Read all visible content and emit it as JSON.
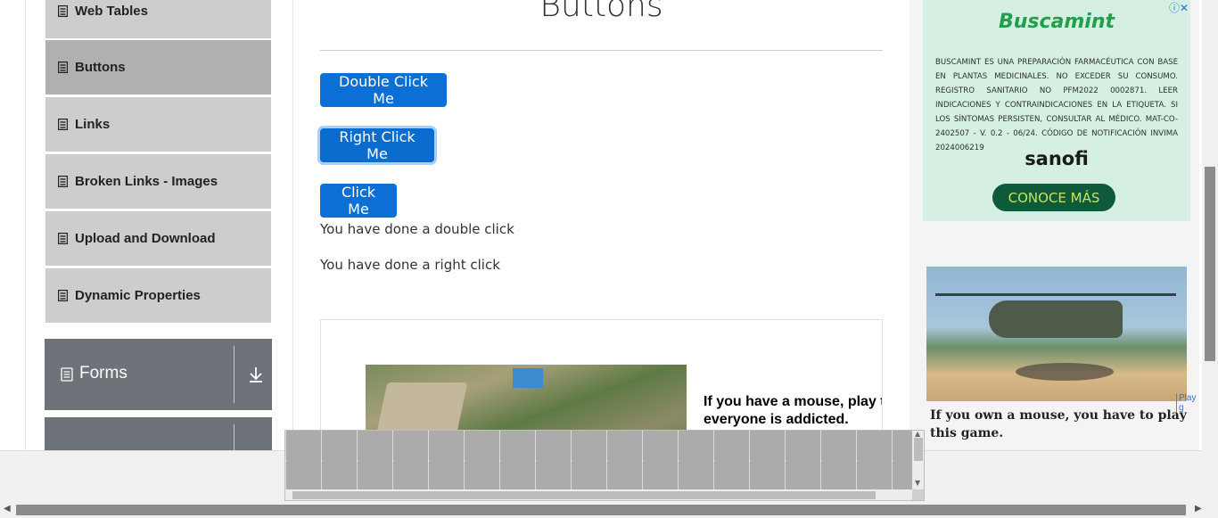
{
  "sidebar": {
    "items": [
      {
        "label": "Web Tables",
        "icon": "document-icon",
        "active": false
      },
      {
        "label": "Buttons",
        "icon": "document-icon",
        "active": true
      },
      {
        "label": "Links",
        "icon": "document-icon",
        "active": false
      },
      {
        "label": "Broken Links - Images",
        "icon": "document-icon",
        "active": false
      },
      {
        "label": "Upload and Download",
        "icon": "document-icon",
        "active": false
      },
      {
        "label": "Dynamic Properties",
        "icon": "document-icon",
        "active": false
      }
    ],
    "groups": [
      {
        "label": "Forms",
        "icon": "notes-icon"
      }
    ]
  },
  "main": {
    "title": "Buttons",
    "buttons": {
      "double_click": "Double Click Me",
      "right_click": "Right Click Me",
      "click": "Click Me"
    },
    "messages": {
      "double_click": "You have done a double click",
      "right_click": "You have done a right click"
    },
    "ad_text": "If you have a mouse, play this everyone is addicted."
  },
  "right_ads": {
    "ad1": {
      "brand": "Buscamint",
      "legal": "BUSCAMINT ES UNA PREPARACIÓN FARMACÉUTICA CON BASE EN PLANTAS MEDICINALES. NO EXCEDER SU CONSUMO. REGISTRO SANITARIO NO PFM2022 0002871. LEER INDICACIONES Y CONTRAINDICACIONES EN LA ETIQUETA. SI LOS SÍNTOMAS PERSISTEN, CONSULTAR AL MÉDICO. MAT-CO-2402507 - V. 0.2 - 06/24. CÓDIGO DE NOTIFICACIÓN INVIMA 2024006219",
      "company": "sanofi",
      "cta": "CONOCE MÁS",
      "info_icon": "ⓘ✕"
    },
    "ad2": {
      "text": "If you own a mouse, you have to play this game.",
      "side_tab": "Play g"
    }
  },
  "colors": {
    "primary_button": "#0b6fd6",
    "sidebar_item": "#cdcdcd",
    "sidebar_active": "#b0b0b0",
    "group_header": "#6e737a"
  }
}
